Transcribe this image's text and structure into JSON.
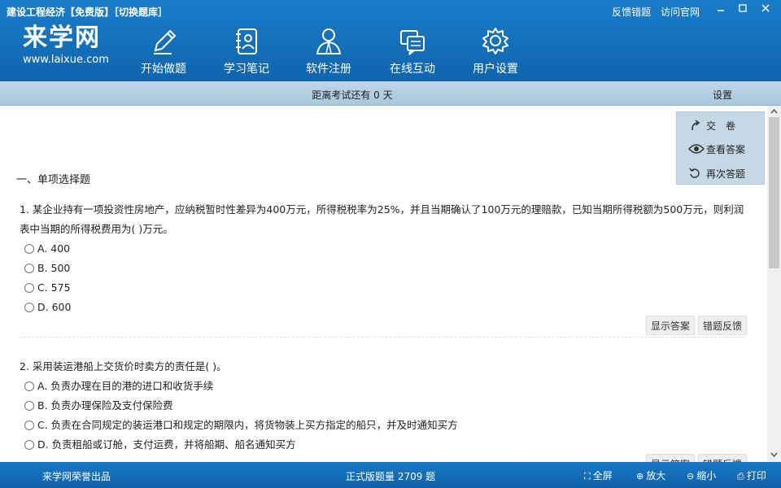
{
  "window": {
    "title": "建设工程经济【免费版】［切换题库］",
    "links": [
      "反馈错题",
      "访问官网"
    ]
  },
  "logo": {
    "main": "来学网",
    "sub": "www.laixue.com"
  },
  "nav": [
    {
      "label": "开始做题",
      "icon": "pencil-icon"
    },
    {
      "label": "学习笔记",
      "icon": "notebook-icon"
    },
    {
      "label": "软件注册",
      "icon": "user-register-icon"
    },
    {
      "label": "在线互动",
      "icon": "chat-icon"
    },
    {
      "label": "用户设置",
      "icon": "gear-icon"
    }
  ],
  "countdown": {
    "text": "距离考试还有 0 天",
    "settings": "设置"
  },
  "side_panel": {
    "submit": "交　卷",
    "view_answer": "查看答案",
    "retry": "再次答题"
  },
  "section_title": "一、单项选择题",
  "questions": [
    {
      "text": "1. 某企业持有一项投资性房地产，应纳税暂时性差异为400万元，所得税税率为25%，并且当期确认了100万元的理赔款，已知当期所得税额为500万元，则利润表中当期的所得税费用为( )万元。",
      "options": [
        "A. 400",
        "B. 500",
        "C. 575",
        "D. 600"
      ]
    },
    {
      "text": "2. 采用装运港船上交货价时卖方的责任是( )。",
      "options": [
        "A. 负责办理在目的港的进口和收货手续",
        "B. 负责办理保险及支付保险费",
        "C. 负责在合同规定的装运港口和规定的期限内，将货物装上买方指定的船只，并及时通知买方",
        "D. 负责租船或订舱，支付运费，并将船期、船名通知买方"
      ]
    }
  ],
  "actions": {
    "show_answer": "显示答案",
    "report_error": "错题反馈"
  },
  "footer": {
    "copyright": "来学网荣誉出品",
    "total": "正式版题量 2709 题",
    "fullscreen": "全屏",
    "zoom_in": "放大",
    "zoom_out": "缩小",
    "print": "打印"
  }
}
